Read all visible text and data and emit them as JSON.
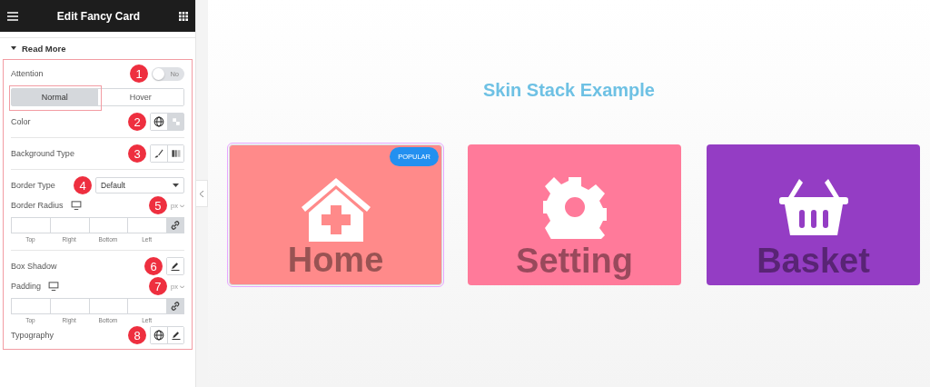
{
  "header": {
    "title": "Edit Fancy Card"
  },
  "section": {
    "title": "Read More",
    "expanded": true
  },
  "controls": [
    {
      "kind": "switch",
      "label": "Attention",
      "marker": "1",
      "on": false,
      "switch_label": "No"
    },
    {
      "kind": "tabs",
      "tabs": [
        {
          "label": "Normal",
          "selected": true
        },
        {
          "label": "Hover",
          "selected": false
        }
      ]
    },
    {
      "kind": "color",
      "label": "Color",
      "marker": "2",
      "options": [
        {
          "selected": false
        },
        {
          "selected": true
        }
      ]
    },
    {
      "kind": "divider"
    },
    {
      "kind": "background",
      "label": "Background Type",
      "marker": "3",
      "options": [
        {
          "selected": false
        },
        {
          "selected": false
        }
      ]
    },
    {
      "kind": "divider"
    },
    {
      "kind": "select",
      "label": "Border Type",
      "marker": "4",
      "value": "Default"
    },
    {
      "kind": "dimensions",
      "label": "Border Radius",
      "marker": "5",
      "unit": "px",
      "fields": [
        "Top",
        "Right",
        "Bottom",
        "Left"
      ]
    },
    {
      "kind": "divider"
    },
    {
      "kind": "popover",
      "label": "Box Shadow",
      "marker": "6"
    },
    {
      "kind": "dimensions",
      "label": "Padding",
      "marker": "7",
      "unit": "px",
      "fields": [
        "Top",
        "Right",
        "Bottom",
        "Left"
      ]
    },
    {
      "kind": "typography",
      "label": "Typography",
      "marker": "8"
    }
  ],
  "preview": {
    "title": "Skin Stack Example",
    "cards": [
      {
        "kind": "home",
        "title": "Home",
        "color": "#ff8a8a",
        "badge": "POPULAR",
        "selected": true
      },
      {
        "kind": "gear",
        "title": "Setting",
        "color": "#ff7a9a",
        "selected": false
      },
      {
        "kind": "basket",
        "title": "Basket",
        "color": "#943dc4",
        "selected": false
      }
    ]
  }
}
